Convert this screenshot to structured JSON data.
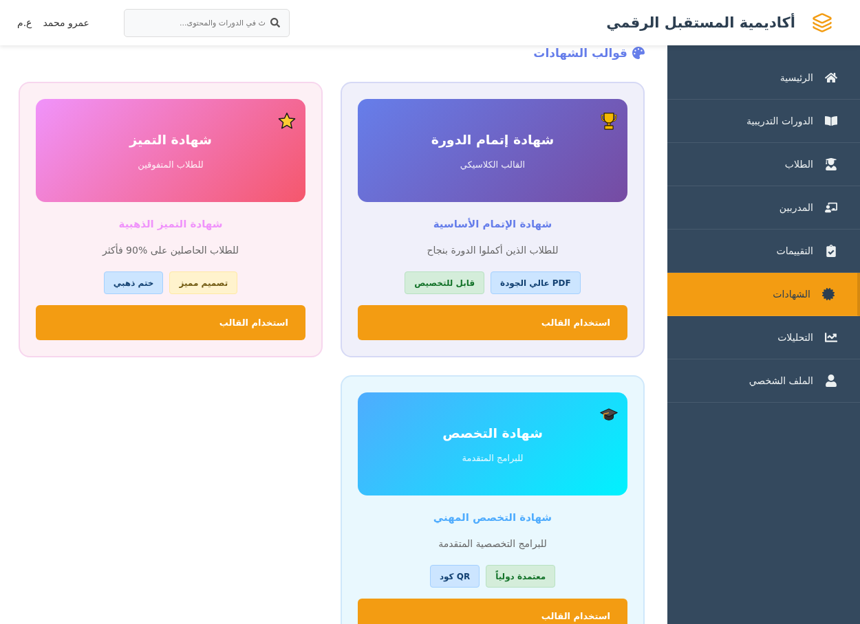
{
  "header": {
    "brand": "أكاديمية المستقبل الرقمي",
    "search": {
      "placeholder": "ث في الدورات والمحتوى..."
    },
    "user": {
      "name": "عمرو محمد",
      "initials": "ع.م"
    }
  },
  "sidebar": {
    "items": [
      {
        "label": "الرئيسية",
        "selected": false
      },
      {
        "label": "الدورات التدريبية",
        "selected": false
      },
      {
        "label": "الطلاب",
        "selected": false
      },
      {
        "label": "المدربين",
        "selected": false
      },
      {
        "label": "التقييمات",
        "selected": false
      },
      {
        "label": "الشهادات",
        "selected": true
      },
      {
        "label": "التحليلات",
        "selected": false
      },
      {
        "label": "الملف الشخصي",
        "selected": false
      }
    ]
  },
  "section_title": "قوالب الشهادات",
  "templates": [
    {
      "title": "شهادة إتمام الدورة",
      "subtitle": "القالب الكلاسيكي",
      "name": "شهادة الإتمام الأساسية",
      "description": "للطلاب الذين أكملوا الدورة بنجاح",
      "tags": [
        {
          "label": "PDF عالي الجودة",
          "color": "#cce5ff"
        },
        {
          "label": "قابل للتخصيص",
          "color": "#d4edda"
        }
      ],
      "button": "استخدام القالب"
    },
    {
      "title": "شهادة التميز",
      "subtitle": "للطلاب المتفوقين",
      "name": "شهادة التميز الذهبية",
      "description": "للطلاب الحاصلين على %90 فأكثر",
      "tags": [
        {
          "label": "تصميم مميز",
          "color": "#fff3cd"
        },
        {
          "label": "ختم ذهبي",
          "color": "#cce5ff"
        }
      ],
      "button": "استخدام القالب"
    },
    {
      "title": "شهادة التخصص",
      "subtitle": "للبرامج المتقدمة",
      "name": "شهادة التخصص المهني",
      "description": "للبرامج التخصصية المتقدمة",
      "tags": [
        {
          "label": "معتمدة دولياً",
          "color": "#d4edda"
        },
        {
          "label": "QR كود",
          "color": "#cce5ff"
        }
      ],
      "button": "استخدام القالب"
    }
  ]
}
